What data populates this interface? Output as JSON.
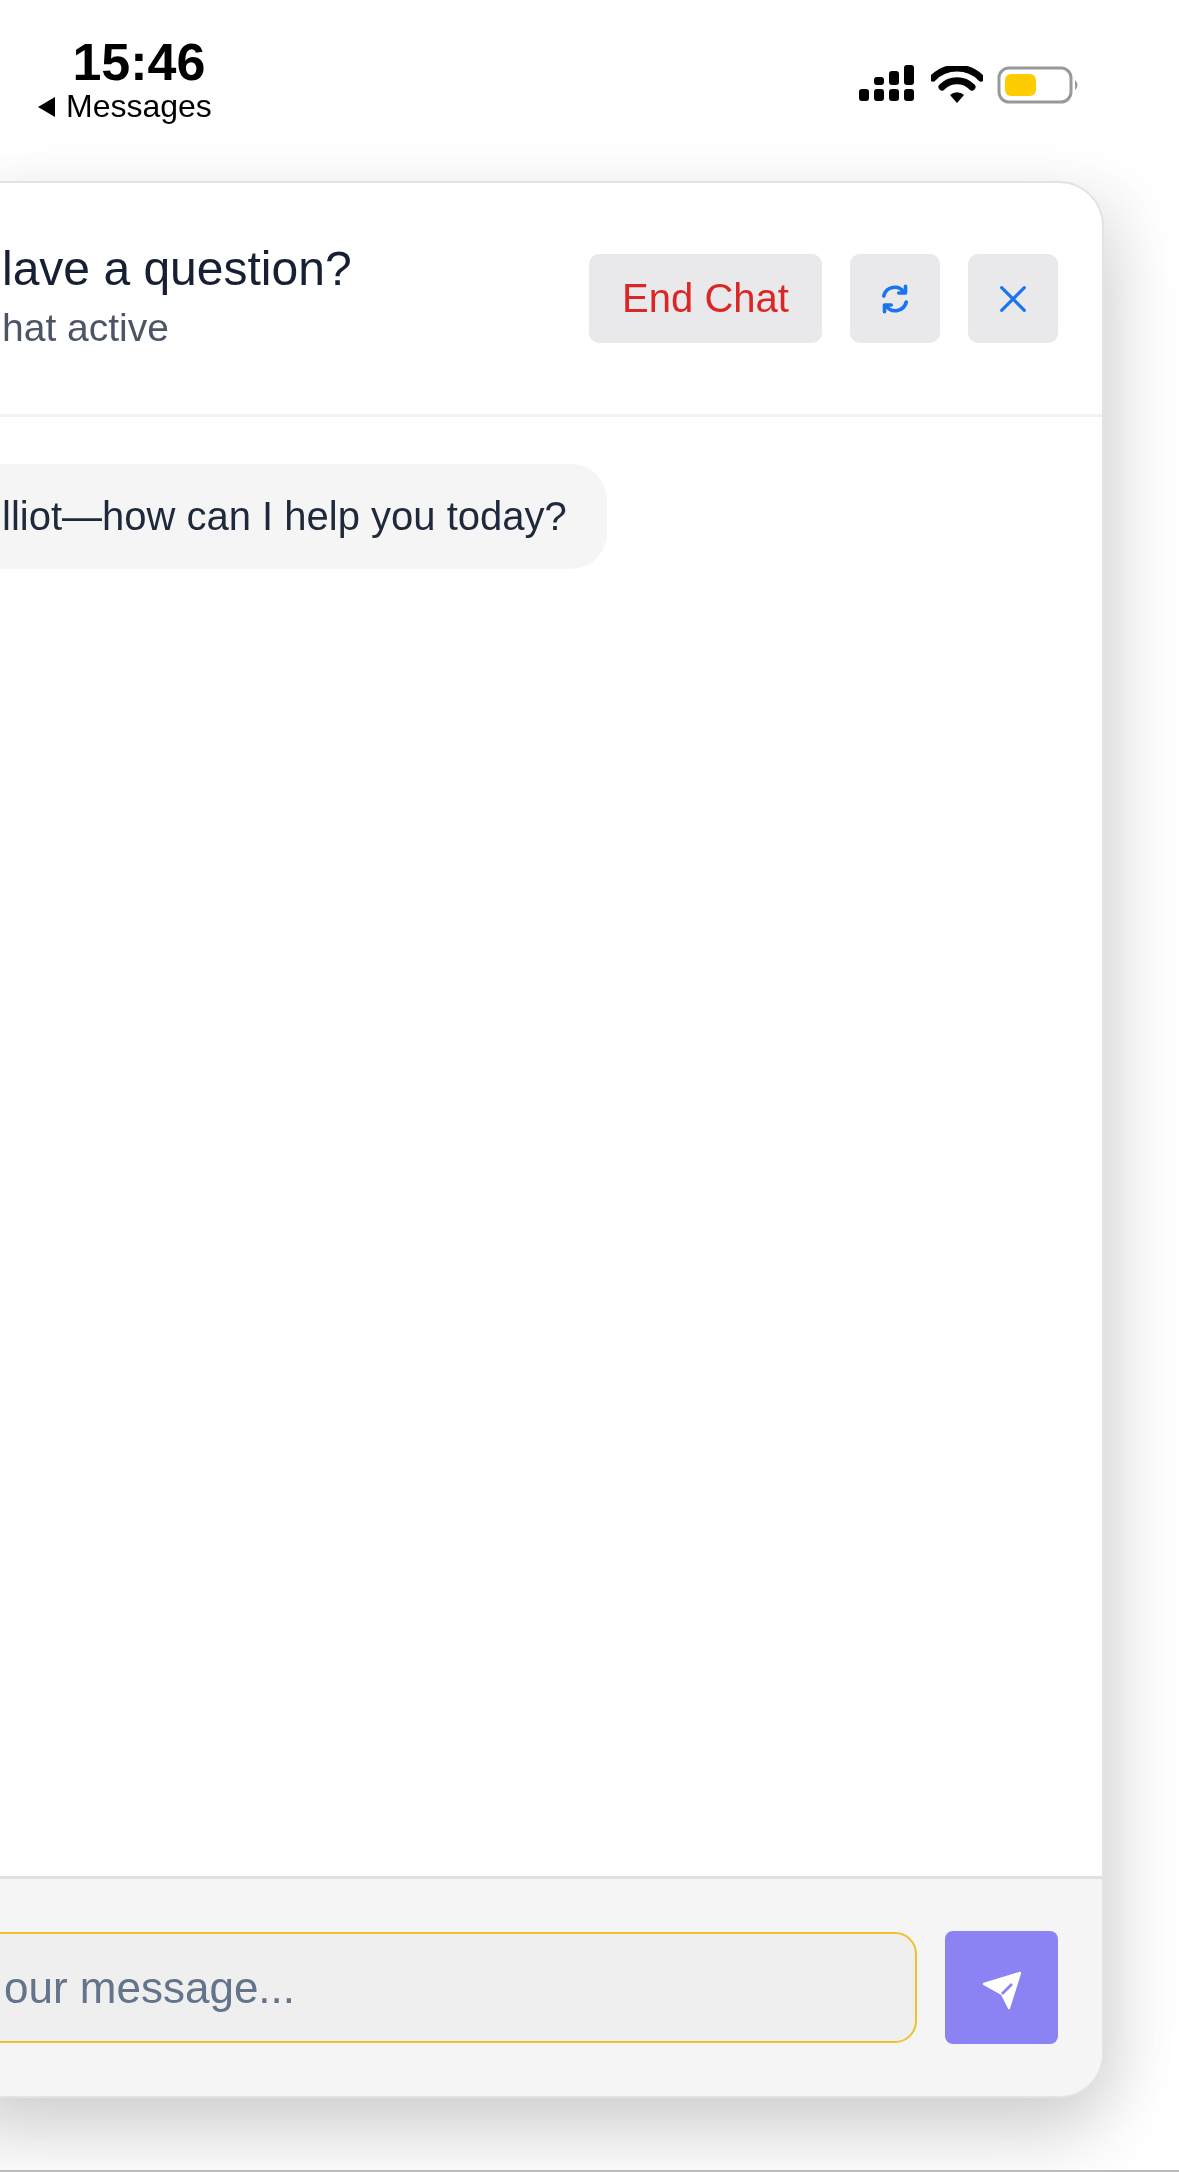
{
  "status_bar": {
    "time": "15:46",
    "back_label": "Messages"
  },
  "chat": {
    "title": "lave a question?",
    "status": "hat active",
    "buttons": [
      {
        "kind": "end",
        "label": "End Chat"
      },
      {
        "kind": "refresh"
      },
      {
        "kind": "close"
      }
    ]
  },
  "messages": [
    {
      "text": "lliot—how can I help you today?"
    }
  ],
  "composer": {
    "placeholder": "our message..."
  }
}
